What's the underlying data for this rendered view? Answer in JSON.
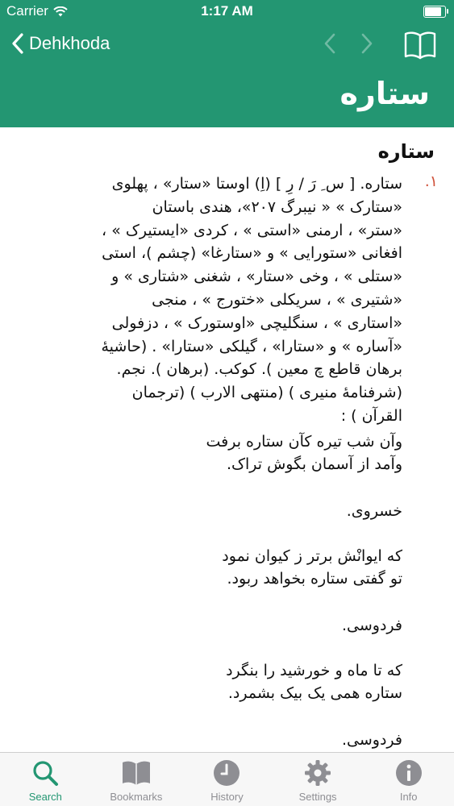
{
  "status": {
    "carrier": "Carrier",
    "time": "1:17 AM"
  },
  "nav": {
    "back_label": "Dehkhoda",
    "title": "ستاره"
  },
  "content": {
    "headword": "ستاره",
    "entry_number": "۱.",
    "lines": [
      "ستاره. [ س ِ رَ / رِ ] (اِ) اوستا «ستار» ، پهلوی",
      "«ستارک » «   نیبرگ ۲۰۷»، هندی باستان",
      "«ستر» ، ارمنی «استی » ، کردی «ایستیرک » ،",
      "افغانی «ستورایی » و «ستارغا» (چشم )، استی",
      "«ستلی » ، وخی «ستار» ، شغنی «شتاری » و",
      "«شتیری » ، سریکلی «ختورج » ، منجی",
      "«استاری » ، سنگلیچی «اوستورک » ، دزفولی",
      "«آساره » و «ستارا» ، گیلکی «ستارا» . (حاشیهٔ",
      "برهان قاطع چ معین ). کوکب. (برهان ). نجم.",
      "(شرفنامهٔ منیری ) (منتهی الارب ) (ترجمان",
      "القرآن ) :"
    ],
    "verse1": [
      "وآن شب تیره کآن ستاره برفت",
      "وآمد از آسمان بگوش تراک."
    ],
    "poet1": "خسروی.",
    "verse2": [
      "که ایوانْش برتر ز کیوان نمود",
      "تو گفتی ستاره بخواهد ربود."
    ],
    "poet2": "فردوسی.",
    "verse3": [
      "که تا ماه و خورشید را بنگرد",
      "ستاره همی یک بیک بشمرد."
    ],
    "poet3": "فردوسی."
  },
  "tabs": [
    {
      "label": "Search",
      "icon": "search-icon",
      "active": true
    },
    {
      "label": "Bookmarks",
      "icon": "bookmarks-icon",
      "active": false
    },
    {
      "label": "History",
      "icon": "history-icon",
      "active": false
    },
    {
      "label": "Settings",
      "icon": "settings-icon",
      "active": false
    },
    {
      "label": "Info",
      "icon": "info-icon",
      "active": false
    }
  ],
  "colors": {
    "accent": "#239672",
    "entry_number": "#d0533c",
    "inactive_tab": "#8e8e93"
  }
}
